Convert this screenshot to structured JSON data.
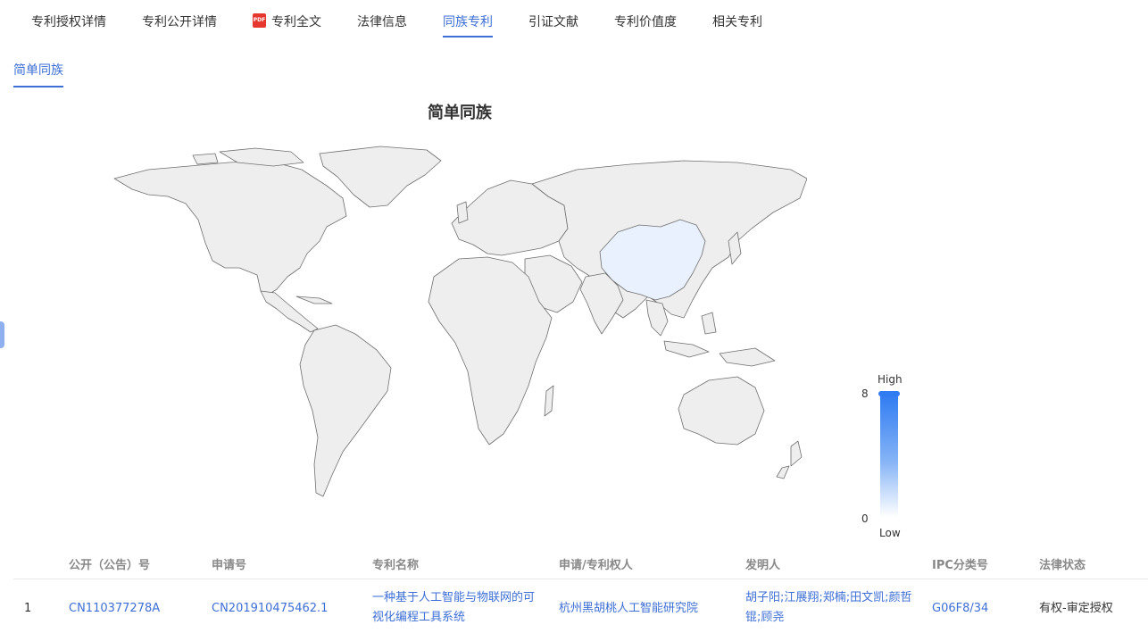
{
  "tabs": [
    {
      "label": "专利授权详情"
    },
    {
      "label": "专利公开详情"
    },
    {
      "label": "专利全文",
      "icon": "pdf-icon",
      "icon_text": "PDF"
    },
    {
      "label": "法律信息"
    },
    {
      "label": "同族专利",
      "active": true
    },
    {
      "label": "引证文献"
    },
    {
      "label": "专利价值度"
    },
    {
      "label": "相关专利"
    }
  ],
  "sub_tab": {
    "label": "简单同族"
  },
  "chart_data": {
    "type": "choropleth-map",
    "title": "简单同族",
    "regions": [
      {
        "name": "China",
        "value": 1
      }
    ],
    "visual_map": {
      "min": 0,
      "max": 8,
      "high_label": "High",
      "low_label": "Low",
      "min_label": "0",
      "max_label": "8",
      "colors": {
        "high": "#2f7bf2",
        "low": "#ffffff",
        "land": "#eeeeee",
        "highlight": "#e8f1fd"
      }
    }
  },
  "table": {
    "columns": [
      "公开（公告）号",
      "申请号",
      "专利名称",
      "申请/专利权人",
      "发明人",
      "IPC分类号",
      "法律状态"
    ],
    "rows": [
      {
        "index": "1",
        "pub_no": "CN110377278A",
        "app_no": "CN201910475462.1",
        "title": "一种基于人工智能与物联网的可视化编程工具系统",
        "applicant": "杭州黑胡桃人工智能研究院",
        "inventors": "胡子阳;江展翔;郑楠;田文凯;颜哲锟;顾尧",
        "ipc": "G06F8/34",
        "status": "有权-审定授权"
      }
    ]
  }
}
